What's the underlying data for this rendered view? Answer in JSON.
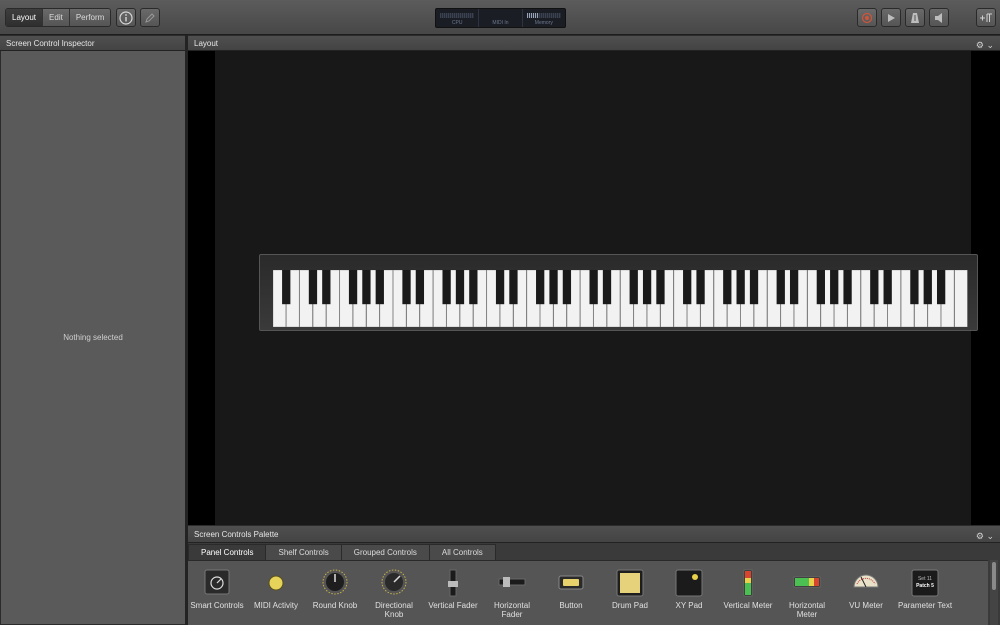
{
  "toolbar": {
    "modes": [
      "Layout",
      "Edit",
      "Perform"
    ],
    "active_mode": "Layout",
    "lcd": [
      {
        "label": "CPU",
        "level": 0.0
      },
      {
        "label": "MIDI In",
        "level": 0.0
      },
      {
        "label": "Memory",
        "level": 0.35
      }
    ],
    "accent": "#d0553a"
  },
  "inspector": {
    "title": "Screen Control Inspector",
    "empty_text": "Nothing selected"
  },
  "layout": {
    "title": "Layout",
    "keyboard": {
      "white_keys": 52
    }
  },
  "palette": {
    "title": "Screen Controls Palette",
    "tabs": [
      "Panel Controls",
      "Shelf Controls",
      "Grouped Controls",
      "All Controls"
    ],
    "active_tab": "Panel Controls",
    "items": [
      {
        "label": "Smart Controls",
        "icon": "smart-controls-icon"
      },
      {
        "label": "MIDI Activity",
        "icon": "midi-activity-icon"
      },
      {
        "label": "Round Knob",
        "icon": "round-knob-icon"
      },
      {
        "label": "Directional Knob",
        "icon": "directional-knob-icon"
      },
      {
        "label": "Vertical Fader",
        "icon": "vertical-fader-icon"
      },
      {
        "label": "Horizontal Fader",
        "icon": "horizontal-fader-icon"
      },
      {
        "label": "Button",
        "icon": "button-icon"
      },
      {
        "label": "Drum Pad",
        "icon": "drum-pad-icon"
      },
      {
        "label": "XY Pad",
        "icon": "xy-pad-icon"
      },
      {
        "label": "Vertical Meter",
        "icon": "vertical-meter-icon"
      },
      {
        "label": "Horizontal Meter",
        "icon": "horizontal-meter-icon"
      },
      {
        "label": "VU Meter",
        "icon": "vu-meter-icon"
      },
      {
        "label": "Parameter Text",
        "icon": "parameter-text-icon"
      }
    ],
    "param_text_line1": "Set 11",
    "param_text_line2": "Patch 5"
  }
}
